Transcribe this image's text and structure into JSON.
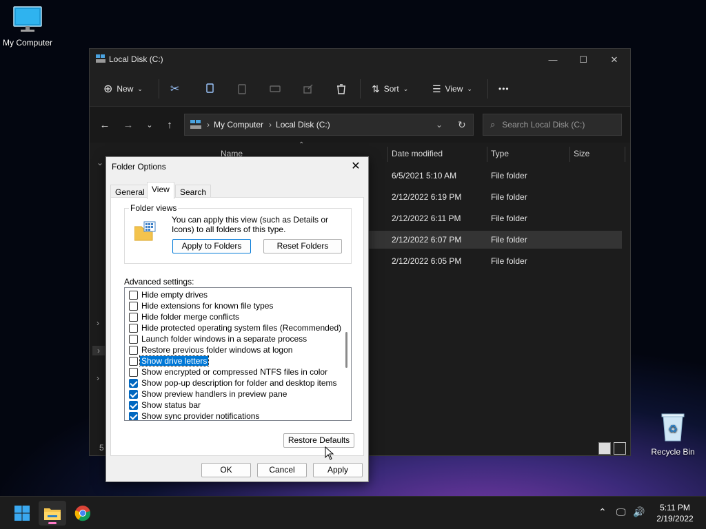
{
  "desktop": {
    "icons": [
      {
        "label": "My Computer"
      },
      {
        "label": "Recycle Bin"
      }
    ]
  },
  "explorer": {
    "title": "Local Disk (C:)",
    "toolbar": {
      "new_label": "New",
      "sort_label": "Sort",
      "view_label": "View",
      "more_label": "•••"
    },
    "address": {
      "crumbs": [
        "My Computer",
        "Local Disk (C:)"
      ]
    },
    "search": {
      "placeholder": "Search Local Disk (C:)"
    },
    "columns": {
      "name": "Name",
      "date": "Date modified",
      "type": "Type",
      "size": "Size"
    },
    "rows": [
      {
        "date": "6/5/2021 5:10 AM",
        "type": "File folder"
      },
      {
        "date": "2/12/2022 6:19 PM",
        "type": "File folder"
      },
      {
        "date": "2/12/2022 6:11 PM",
        "type": "File folder"
      },
      {
        "date": "2/12/2022 6:07 PM",
        "type": "File folder"
      },
      {
        "date": "2/12/2022 6:05 PM",
        "type": "File folder"
      }
    ],
    "status_count": "5"
  },
  "dialog": {
    "title": "Folder Options",
    "tabs": [
      "General",
      "View",
      "Search"
    ],
    "folder_views": {
      "legend": "Folder views",
      "text": "You can apply this view (such as Details or Icons) to all folders of this type.",
      "apply_label": "Apply to Folders",
      "reset_label": "Reset Folders"
    },
    "advanced_label": "Advanced settings:",
    "settings": [
      {
        "label": "Hide empty drives",
        "checked": false
      },
      {
        "label": "Hide extensions for known file types",
        "checked": false
      },
      {
        "label": "Hide folder merge conflicts",
        "checked": false
      },
      {
        "label": "Hide protected operating system files (Recommended)",
        "checked": false
      },
      {
        "label": "Launch folder windows in a separate process",
        "checked": false
      },
      {
        "label": "Restore previous folder windows at logon",
        "checked": false
      },
      {
        "label": "Show drive letters",
        "checked": false,
        "selected": true
      },
      {
        "label": "Show encrypted or compressed NTFS files in color",
        "checked": false
      },
      {
        "label": "Show pop-up description for folder and desktop items",
        "checked": true
      },
      {
        "label": "Show preview handlers in preview pane",
        "checked": true
      },
      {
        "label": "Show status bar",
        "checked": true
      },
      {
        "label": "Show sync provider notifications",
        "checked": true
      }
    ],
    "restore_defaults_label": "Restore Defaults",
    "ok_label": "OK",
    "cancel_label": "Cancel",
    "apply_label": "Apply"
  },
  "taskbar": {
    "time": "5:11 PM",
    "date": "2/19/2022"
  },
  "colors": {
    "accent": "#0078d7",
    "checkbox_on": "#0067c0"
  }
}
